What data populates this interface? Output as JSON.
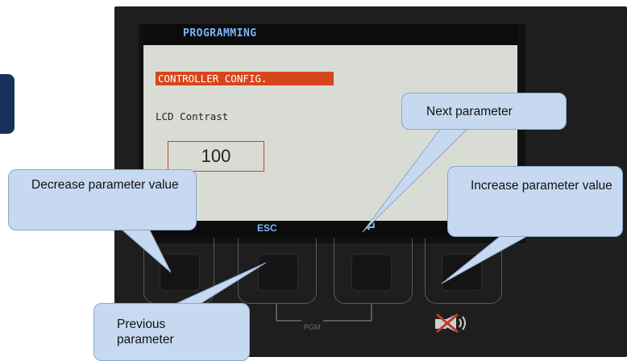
{
  "screen": {
    "title": "PROGRAMMING",
    "section": "CONTROLLER CONFIG.",
    "parameter_name": "LCD Contrast",
    "parameter_value": "100",
    "softkeys": {
      "left_arrow_icon": "arrow-left-icon",
      "esc_label": "ESC",
      "enter_icon": "enter-icon"
    }
  },
  "panel": {
    "pgm_label": "PGM",
    "mute_icon": "speaker-mute-icon"
  },
  "callouts": {
    "decrease": "Decrease parameter value",
    "next": "Next parameter",
    "increase": "Increase parameter value",
    "previous": "Previous parameter"
  },
  "colors": {
    "screen_accent": "#7ab6ff",
    "section_highlight": "#d5461c",
    "callout_fill": "#c7d9f0",
    "device_body": "#1e1e1e"
  }
}
